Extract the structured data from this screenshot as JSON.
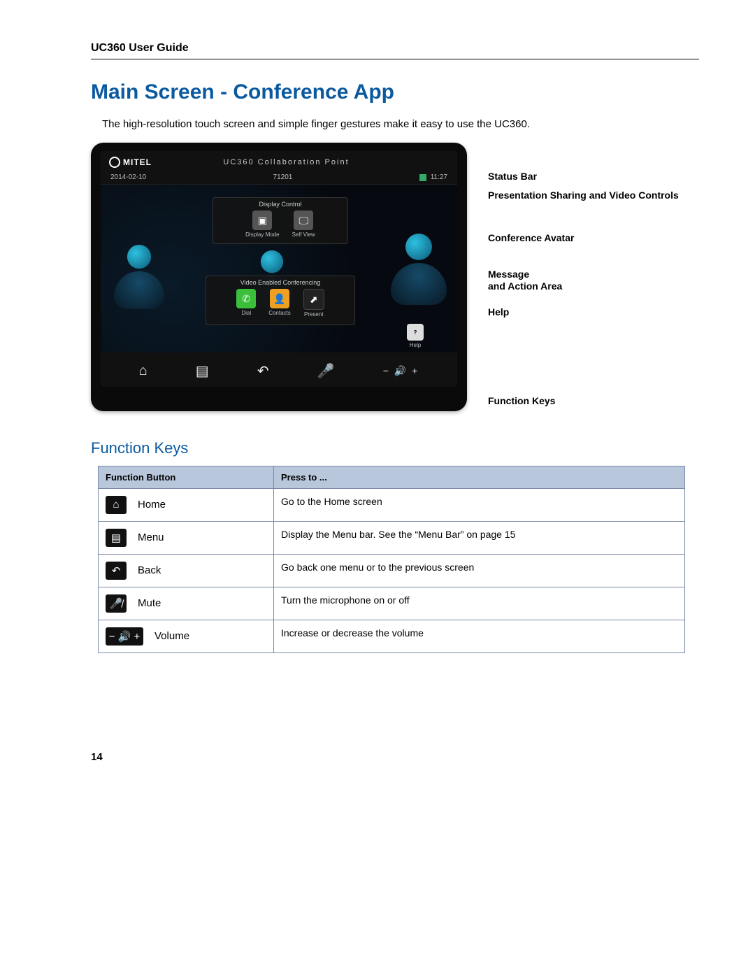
{
  "header": {
    "doc_title": "UC360 User Guide"
  },
  "title": "Main Screen - Conference App",
  "intro": "The high-resolution touch screen and simple finger gestures make it easy to use the UC360.",
  "device": {
    "brand": "MITEL",
    "collab": "UC360 Collaboration Point",
    "date": "2014-02-10",
    "extension": "71201",
    "time": "11:27",
    "display_control_label": "Display Control",
    "tile_display_mode": "Display Mode",
    "tile_self_view": "Self View",
    "video_conf_label": "Video Enabled Conferencing",
    "tile_dial": "Dial",
    "tile_contacts": "Contacts",
    "tile_present": "Present",
    "help_label": "Help",
    "vol_text": "− 🔊 +"
  },
  "callouts": {
    "status_bar": "Status Bar",
    "presentation": "Presentation Sharing and Video Controls",
    "avatar": "Conference Avatar",
    "message": "Message\nand Action Area",
    "help": "Help",
    "function_keys": "Function Keys"
  },
  "section_heading": "Function Keys",
  "table": {
    "col1": "Function Button",
    "col2": "Press to ...",
    "rows": [
      {
        "icon": "⌂",
        "name": "Home",
        "desc": "Go to the Home screen"
      },
      {
        "icon": "▤",
        "name": "Menu",
        "desc": "Display the Menu bar. See the “Menu Bar” on page 15"
      },
      {
        "icon": "↶",
        "name": "Back",
        "desc": "Go back one menu or to the previous screen"
      },
      {
        "icon": "🎤̸",
        "name": "Mute",
        "desc": "Turn the microphone on or off"
      },
      {
        "icon": "− 🔊 +",
        "name": "Volume",
        "desc": "Increase or decrease the volume",
        "wide": true
      }
    ]
  },
  "page_number": "14"
}
